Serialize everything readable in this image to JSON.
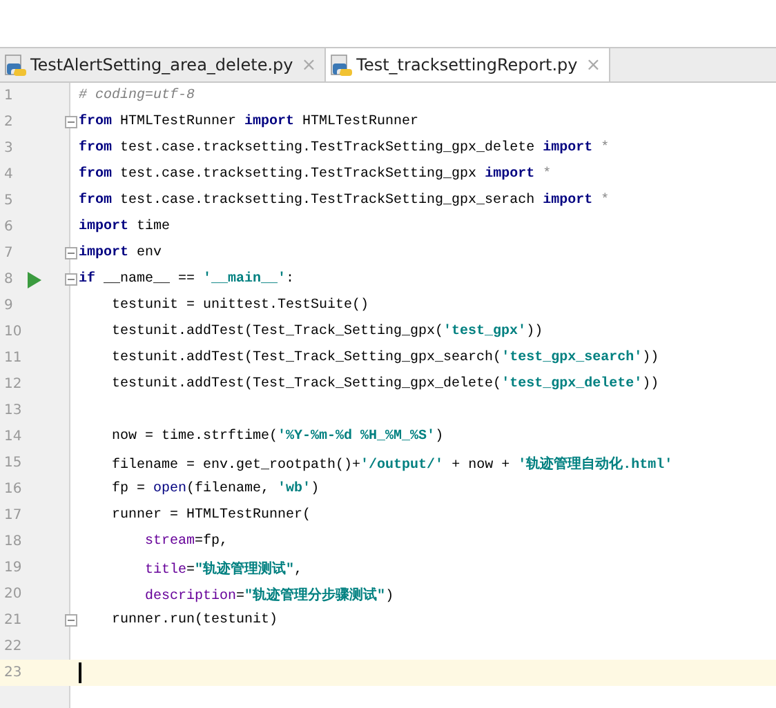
{
  "tabs": [
    {
      "label": "TestAlertSetting_area_delete.py",
      "close": "×",
      "selected": false
    },
    {
      "label": "Test_tracksettingReport.py",
      "close": "×",
      "selected": true
    }
  ],
  "editor": {
    "lines": [
      {
        "number": "1",
        "run": false,
        "fold": false,
        "current": false,
        "tokens": [
          {
            "kind": "comment",
            "text": "# coding=utf-8"
          }
        ]
      },
      {
        "number": "2",
        "run": false,
        "fold": true,
        "current": false,
        "tokens": [
          {
            "kind": "keyword",
            "text": "from"
          },
          {
            "kind": "plain",
            "text": " HTMLTestRunner "
          },
          {
            "kind": "keyword",
            "text": "import"
          },
          {
            "kind": "plain",
            "text": " HTMLTestRunner"
          }
        ]
      },
      {
        "number": "3",
        "run": false,
        "fold": false,
        "current": false,
        "tokens": [
          {
            "kind": "keyword",
            "text": "from"
          },
          {
            "kind": "plain",
            "text": " test.case.tracksetting.TestTrackSetting_gpx_delete "
          },
          {
            "kind": "keyword",
            "text": "import"
          },
          {
            "kind": "star",
            "text": " *"
          }
        ]
      },
      {
        "number": "4",
        "run": false,
        "fold": false,
        "current": false,
        "tokens": [
          {
            "kind": "keyword",
            "text": "from"
          },
          {
            "kind": "plain",
            "text": " test.case.tracksetting.TestTrackSetting_gpx "
          },
          {
            "kind": "keyword",
            "text": "import"
          },
          {
            "kind": "star",
            "text": " *"
          }
        ]
      },
      {
        "number": "5",
        "run": false,
        "fold": false,
        "current": false,
        "tokens": [
          {
            "kind": "keyword",
            "text": "from"
          },
          {
            "kind": "plain",
            "text": " test.case.tracksetting.TestTrackSetting_gpx_serach "
          },
          {
            "kind": "keyword",
            "text": "import"
          },
          {
            "kind": "star",
            "text": " *"
          }
        ]
      },
      {
        "number": "6",
        "run": false,
        "fold": false,
        "current": false,
        "tokens": [
          {
            "kind": "keyword",
            "text": "import"
          },
          {
            "kind": "plain",
            "text": " time"
          }
        ]
      },
      {
        "number": "7",
        "run": false,
        "fold": true,
        "current": false,
        "tokens": [
          {
            "kind": "keyword",
            "text": "import"
          },
          {
            "kind": "plain",
            "text": " env"
          }
        ]
      },
      {
        "number": "8",
        "run": true,
        "fold": true,
        "current": false,
        "tokens": [
          {
            "kind": "keyword",
            "text": "if"
          },
          {
            "kind": "plain",
            "text": " __name__ == "
          },
          {
            "kind": "string",
            "text": "'__main__'"
          },
          {
            "kind": "plain",
            "text": ":"
          }
        ]
      },
      {
        "number": "9",
        "run": false,
        "fold": false,
        "current": false,
        "tokens": [
          {
            "kind": "plain",
            "text": "    testunit = unittest.TestSuite()"
          }
        ]
      },
      {
        "number": "10",
        "run": false,
        "fold": false,
        "current": false,
        "tokens": [
          {
            "kind": "plain",
            "text": "    testunit.addTest(Test_Track_Setting_gpx("
          },
          {
            "kind": "string",
            "text": "'test_gpx'"
          },
          {
            "kind": "plain",
            "text": "))"
          }
        ]
      },
      {
        "number": "11",
        "run": false,
        "fold": false,
        "current": false,
        "tokens": [
          {
            "kind": "plain",
            "text": "    testunit.addTest(Test_Track_Setting_gpx_search("
          },
          {
            "kind": "string",
            "text": "'test_gpx_search'"
          },
          {
            "kind": "plain",
            "text": "))"
          }
        ]
      },
      {
        "number": "12",
        "run": false,
        "fold": false,
        "current": false,
        "tokens": [
          {
            "kind": "plain",
            "text": "    testunit.addTest(Test_Track_Setting_gpx_delete("
          },
          {
            "kind": "string",
            "text": "'test_gpx_delete'"
          },
          {
            "kind": "plain",
            "text": "))"
          }
        ]
      },
      {
        "number": "13",
        "run": false,
        "fold": false,
        "current": false
      },
      {
        "number": "14",
        "run": false,
        "fold": false,
        "current": false,
        "tokens": [
          {
            "kind": "plain",
            "text": "    now = time.strftime("
          },
          {
            "kind": "string",
            "text": "'%Y-%m-%d %H_%M_%S'"
          },
          {
            "kind": "plain",
            "text": ")"
          }
        ]
      },
      {
        "number": "15",
        "run": false,
        "fold": false,
        "current": false,
        "tokens": [
          {
            "kind": "plain",
            "text": "    filename = env.get_rootpath()+"
          },
          {
            "kind": "string",
            "text": "'/output/'"
          },
          {
            "kind": "plain",
            "text": " + now + "
          },
          {
            "kind": "string",
            "text": "'轨迹管理自动化.html'"
          }
        ]
      },
      {
        "number": "16",
        "run": false,
        "fold": false,
        "current": false,
        "tokens": [
          {
            "kind": "plain",
            "text": "    fp = "
          },
          {
            "kind": "builtin",
            "text": "open"
          },
          {
            "kind": "plain",
            "text": "(filename, "
          },
          {
            "kind": "string",
            "text": "'wb'"
          },
          {
            "kind": "plain",
            "text": ")"
          }
        ]
      },
      {
        "number": "17",
        "run": false,
        "fold": false,
        "current": false,
        "tokens": [
          {
            "kind": "plain",
            "text": "    runner = HTMLTestRunner("
          }
        ]
      },
      {
        "number": "18",
        "run": false,
        "fold": false,
        "current": false,
        "tokens": [
          {
            "kind": "param",
            "text": "        stream"
          },
          {
            "kind": "plain",
            "text": "=fp,"
          }
        ]
      },
      {
        "number": "19",
        "run": false,
        "fold": false,
        "current": false,
        "tokens": [
          {
            "kind": "param",
            "text": "        title"
          },
          {
            "kind": "plain",
            "text": "="
          },
          {
            "kind": "string",
            "text": "\"轨迹管理测试\""
          },
          {
            "kind": "plain",
            "text": ","
          }
        ]
      },
      {
        "number": "20",
        "run": false,
        "fold": false,
        "current": false,
        "tokens": [
          {
            "kind": "param",
            "text": "        description"
          },
          {
            "kind": "plain",
            "text": "="
          },
          {
            "kind": "string",
            "text": "\"轨迹管理分步骤测试\""
          },
          {
            "kind": "plain",
            "text": ")"
          }
        ]
      },
      {
        "number": "21",
        "run": false,
        "fold": true,
        "current": false,
        "tokens": [
          {
            "kind": "plain",
            "text": "    runner.run(testunit)"
          }
        ]
      },
      {
        "number": "22",
        "run": false,
        "fold": false,
        "current": false
      },
      {
        "number": "23",
        "run": false,
        "fold": false,
        "current": true
      }
    ]
  }
}
